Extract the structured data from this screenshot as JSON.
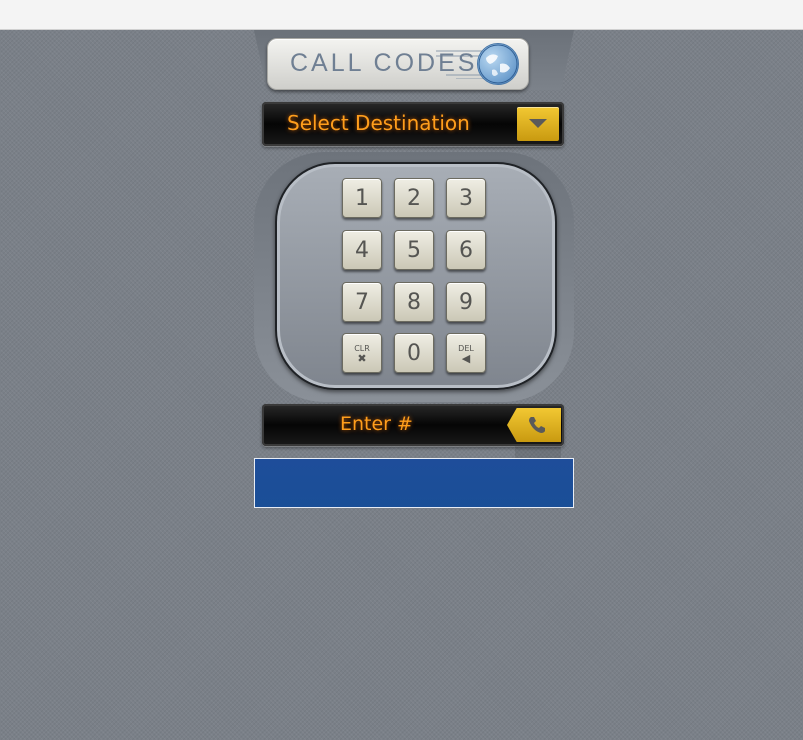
{
  "logo": {
    "text": "CALL CODES",
    "icon": "globe-icon"
  },
  "destination": {
    "label": "Select Destination",
    "icon": "chevron-down-icon"
  },
  "keypad": {
    "keys": [
      "1",
      "2",
      "3",
      "4",
      "5",
      "6",
      "7",
      "8",
      "9",
      "CLR",
      "0",
      "DEL"
    ]
  },
  "enter": {
    "label": "Enter #",
    "icon": "phone-icon"
  },
  "colors": {
    "accent_text": "#ff9e1c",
    "button_yellow": "#e5b824",
    "panel_blue": "#1a4f97"
  }
}
